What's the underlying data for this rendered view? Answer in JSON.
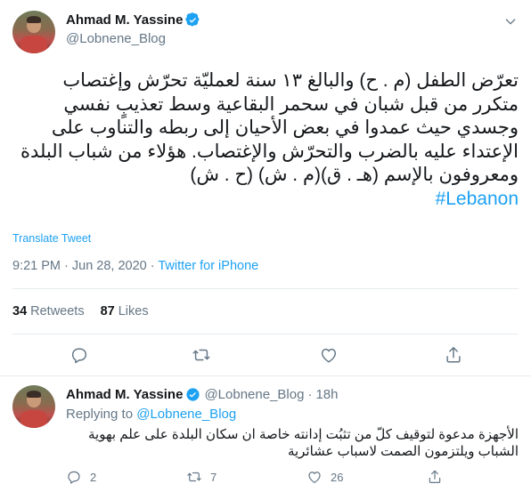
{
  "tweet": {
    "author_name": "Ahmad M. Yassine",
    "author_handle": "@Lobnene_Blog",
    "text": "تعرّض الطفل (م . ح) والبالغ ١٣ سنة لعمليّة تحرّش وإغتصاب متكرر من قبل شبان في سحمر البقاعية وسط تعذيبٍ نفسي وجسدي حيث عمدوا في بعض الأحيان إلى ربطه والتناوب على الإعتداء عليه بالضرب والتحرّش والإغتصاب. هؤلاء من شباب البلدة ومعروفون بالإسم (هـ . ق)(م . ش) (ح . ش)",
    "hashtag": "#Lebanon",
    "translate_label": "Translate Tweet",
    "timestamp": "9:21 PM · Jun 28, 2020",
    "separator": " · ",
    "source": "Twitter for iPhone",
    "retweets_count": "34",
    "retweets_label": "Retweets",
    "likes_count": "87",
    "likes_label": "Likes",
    "icons": {
      "verified": "verified-badge-icon",
      "more": "chevron-down-icon",
      "reply": "reply-icon",
      "retweet": "retweet-icon",
      "like": "heart-icon",
      "share": "share-icon"
    }
  },
  "reply": {
    "author_name": "Ahmad M. Yassine",
    "author_handle": "@Lobnene_Blog",
    "dot": "·",
    "time": "18h",
    "replying_prefix": "Replying to",
    "replying_to": "@Lobnene_Blog",
    "text": "الأجهزة مدعوة لتوقيف كلّ من تثبُت إدانته خاصة ان سكان البلدة على علم بهوية الشباب ويلتزمون الصمت لاسباب عشائرية",
    "reply_count": "2",
    "retweet_count": "7",
    "like_count": "26"
  },
  "colors": {
    "accent": "#1da1f2",
    "text": "#14171a",
    "muted": "#657786",
    "divider": "#e6ecf0"
  }
}
